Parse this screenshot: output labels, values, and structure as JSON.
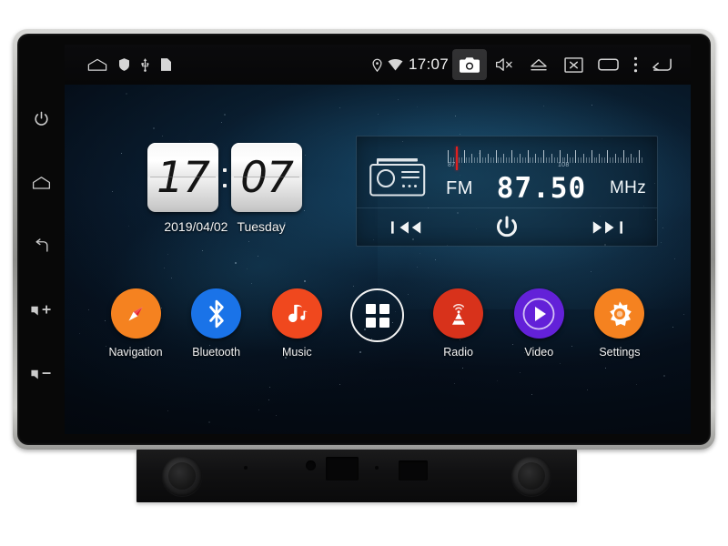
{
  "device": {
    "type": "car-head-unit",
    "bezel_color": "#b9b9b6",
    "screen_bg_color": "#03070d"
  },
  "hardware_keys": [
    {
      "name": "power",
      "icon": "power-icon"
    },
    {
      "name": "home",
      "icon": "home-icon"
    },
    {
      "name": "back",
      "icon": "back-icon"
    },
    {
      "name": "volume-up",
      "icon": "volume-up-icon",
      "label": "+"
    },
    {
      "name": "volume-down",
      "icon": "volume-down-icon",
      "label": "-"
    }
  ],
  "statusbar": {
    "clock": "17:07",
    "left_icons": [
      {
        "name": "home-icon"
      },
      {
        "name": "shield-icon"
      },
      {
        "name": "usb-icon"
      },
      {
        "name": "sd-card-icon"
      }
    ],
    "right_icons": [
      {
        "name": "location-icon",
        "selected": false
      },
      {
        "name": "wifi-icon",
        "selected": false
      }
    ],
    "buttons": [
      {
        "name": "camera-icon",
        "selected": true
      },
      {
        "name": "mute-icon",
        "selected": false
      },
      {
        "name": "eject-icon",
        "selected": false
      },
      {
        "name": "screen-off-icon",
        "selected": false
      },
      {
        "name": "recents-icon",
        "selected": false
      },
      {
        "name": "overflow-menu-icon",
        "selected": false
      },
      {
        "name": "back-icon",
        "selected": false
      }
    ]
  },
  "clock_widget": {
    "hours": "17",
    "minutes": "07",
    "date": "2019/04/02",
    "weekday": "Tuesday"
  },
  "radio_widget": {
    "band": "FM",
    "frequency": "87.50",
    "unit": "MHz",
    "scale_min_label": "87",
    "scale_max_label": "108",
    "needle_position_pct": 4,
    "controls": [
      {
        "name": "prev-station-button",
        "icon": "previous-icon"
      },
      {
        "name": "radio-power-button",
        "icon": "power-icon"
      },
      {
        "name": "next-station-button",
        "icon": "next-icon"
      }
    ]
  },
  "dock": {
    "apps": [
      {
        "label": "Navigation",
        "icon": "compass-icon",
        "color": "#f58220",
        "text_color": "#ffffff"
      },
      {
        "label": "Bluetooth",
        "icon": "bluetooth-icon",
        "color": "#1a73e8",
        "text_color": "#ffffff"
      },
      {
        "label": "Music",
        "icon": "music-note-icon",
        "color": "#f0481e",
        "text_color": "#ffffff"
      },
      {
        "label": "",
        "icon": "app-drawer-icon",
        "color": "transparent",
        "text_color": "#ffffff"
      },
      {
        "label": "Radio",
        "icon": "radio-tower-icon",
        "color": "#d8321b",
        "text_color": "#ffffff"
      },
      {
        "label": "Video",
        "icon": "play-icon",
        "color": "#6321d8",
        "text_color": "#ffffff"
      },
      {
        "label": "Settings",
        "icon": "gear-icon",
        "color": "#f58220",
        "text_color": "#ffffff"
      }
    ]
  }
}
